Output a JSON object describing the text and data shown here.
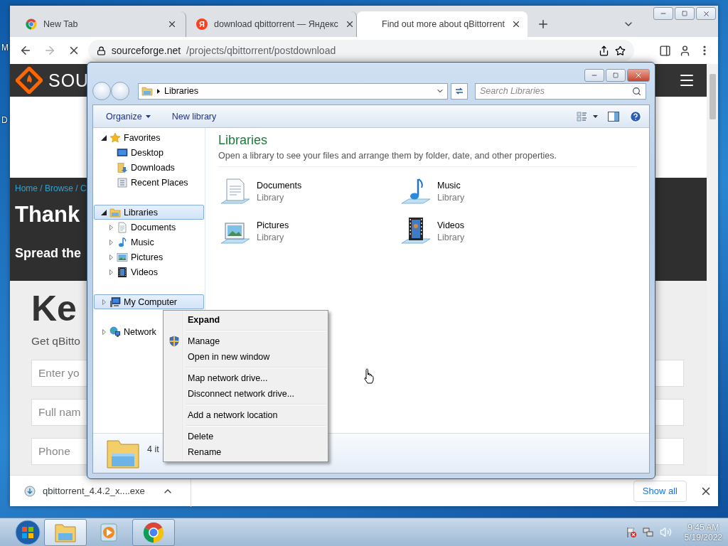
{
  "desktop": {
    "labels": [
      "M",
      "D"
    ]
  },
  "browser": {
    "tabs": [
      {
        "kind": "logo",
        "title": "New Tab",
        "selected": false
      },
      {
        "kind": "letter",
        "badge": "Я",
        "title": "download qbittorrent — Яндекс",
        "selected": false
      },
      {
        "kind": "loading",
        "title": "Find out more about qBittorrent",
        "selected": true
      }
    ],
    "url_host": "sourceforge.net",
    "url_path": "/projects/qbittorrent/postdownload",
    "page": {
      "logo_text": "SOU",
      "breadcrumb": "Home / Browse / C",
      "heading": "Thank",
      "subheading": "Spread the",
      "big_heading": "Ke",
      "intro": "Get qBitto",
      "fields": [
        {
          "placeholder": "Enter yo"
        },
        {
          "placeholder": "Full nam"
        },
        {
          "placeholder": "Phone"
        }
      ]
    },
    "download": {
      "file": "qbittorrent_4.4.2_x....exe",
      "show_all": "Show all"
    }
  },
  "explorer": {
    "breadcrumb": "Libraries",
    "search_placeholder": "Search Libraries",
    "commands": [
      {
        "label": "Organize",
        "menu": true
      },
      {
        "label": "New library",
        "menu": false
      }
    ],
    "nav": [
      {
        "label": "Favorites",
        "kind": "star",
        "expandable": true,
        "expanded": true,
        "selected": false,
        "children": [
          {
            "label": "Desktop",
            "kind": "desktop",
            "expandable": false,
            "selected": false
          },
          {
            "label": "Downloads",
            "kind": "downloads",
            "expandable": false,
            "selected": false
          },
          {
            "label": "Recent Places",
            "kind": "recent",
            "expandable": false,
            "selected": false
          }
        ]
      },
      {
        "label": "Libraries",
        "kind": "libraries",
        "expandable": true,
        "expanded": true,
        "selected": true,
        "children": [
          {
            "label": "Documents",
            "kind": "documents",
            "expandable": true,
            "expanded": false,
            "selected": false
          },
          {
            "label": "Music",
            "kind": "music",
            "expandable": true,
            "expanded": false,
            "selected": false
          },
          {
            "label": "Pictures",
            "kind": "pictures",
            "expandable": true,
            "expanded": false,
            "selected": false
          },
          {
            "label": "Videos",
            "kind": "videos",
            "expandable": true,
            "expanded": false,
            "selected": false
          }
        ]
      },
      {
        "label": "My Computer",
        "kind": "computer",
        "expandable": true,
        "expanded": false,
        "selected": true
      },
      {
        "label": "Network",
        "kind": "network",
        "expandable": true,
        "expanded": false,
        "selected": false
      }
    ],
    "heading": "Libraries",
    "description": "Open a library to see your files and arrange them by folder, date, and other properties.",
    "items": [
      {
        "kind": "documents",
        "name": "Documents",
        "type": "Library"
      },
      {
        "kind": "music",
        "name": "Music",
        "type": "Library"
      },
      {
        "kind": "pictures",
        "name": "Pictures",
        "type": "Library"
      },
      {
        "kind": "videos",
        "name": "Videos",
        "type": "Library"
      }
    ],
    "status": "4 it"
  },
  "context_menu": {
    "groups": [
      [
        {
          "label": "Expand",
          "default": true,
          "kind": "plain"
        }
      ],
      [
        {
          "label": "Manage",
          "default": false,
          "kind": "shield"
        },
        {
          "label": "Open in new window",
          "default": false,
          "kind": "plain"
        }
      ],
      [
        {
          "label": "Map network drive...",
          "default": false,
          "kind": "plain"
        },
        {
          "label": "Disconnect network drive...",
          "default": false,
          "kind": "plain"
        }
      ],
      [
        {
          "label": "Add a network location",
          "default": false,
          "kind": "plain"
        }
      ],
      [
        {
          "label": "Delete",
          "default": false,
          "kind": "plain"
        },
        {
          "label": "Rename",
          "default": false,
          "kind": "plain"
        }
      ]
    ]
  },
  "taskbar": {
    "apps": [
      {
        "kind": "folder",
        "running": true,
        "active": true
      },
      {
        "kind": "media",
        "running": false,
        "active": false
      },
      {
        "kind": "browser",
        "running": true,
        "active": false
      }
    ],
    "time": "9:45 AM",
    "date": "5/19/2022"
  }
}
